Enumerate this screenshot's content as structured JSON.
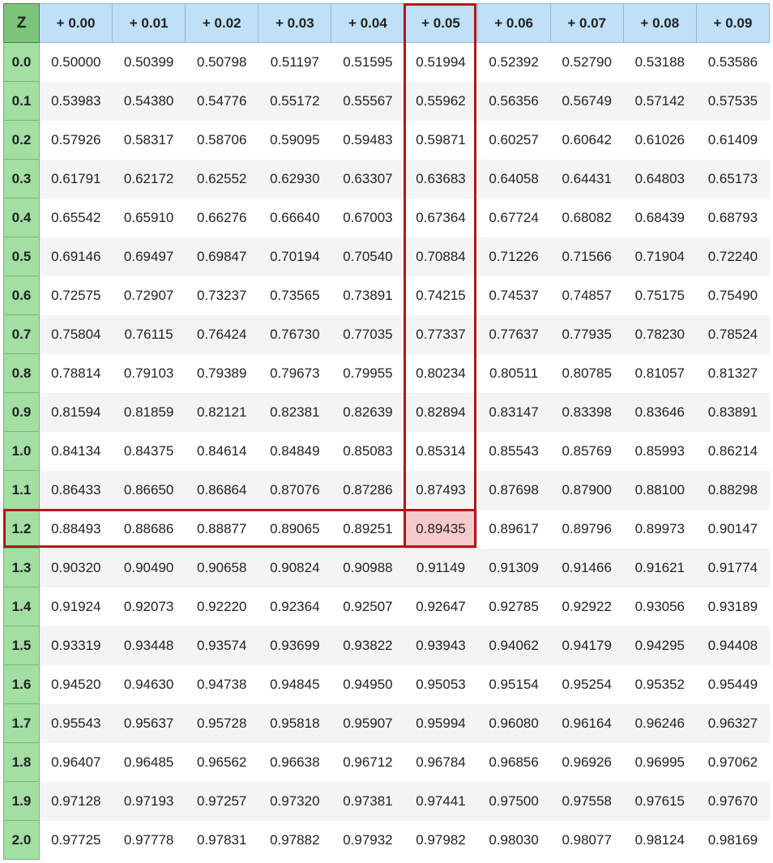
{
  "corner_label": "Z",
  "col_headers": [
    "+ 0.00",
    "+ 0.01",
    "+ 0.02",
    "+ 0.03",
    "+ 0.04",
    "+ 0.05",
    "+ 0.06",
    "+ 0.07",
    "+ 0.08",
    "+ 0.09"
  ],
  "row_headers": [
    "0.0",
    "0.1",
    "0.2",
    "0.3",
    "0.4",
    "0.5",
    "0.6",
    "0.7",
    "0.8",
    "0.9",
    "1.0",
    "1.1",
    "1.2",
    "1.3",
    "1.4",
    "1.5",
    "1.6",
    "1.7",
    "1.8",
    "1.9",
    "2.0"
  ],
  "cells": [
    [
      "0.50000",
      "0.50399",
      "0.50798",
      "0.51197",
      "0.51595",
      "0.51994",
      "0.52392",
      "0.52790",
      "0.53188",
      "0.53586"
    ],
    [
      "0.53983",
      "0.54380",
      "0.54776",
      "0.55172",
      "0.55567",
      "0.55962",
      "0.56356",
      "0.56749",
      "0.57142",
      "0.57535"
    ],
    [
      "0.57926",
      "0.58317",
      "0.58706",
      "0.59095",
      "0.59483",
      "0.59871",
      "0.60257",
      "0.60642",
      "0.61026",
      "0.61409"
    ],
    [
      "0.61791",
      "0.62172",
      "0.62552",
      "0.62930",
      "0.63307",
      "0.63683",
      "0.64058",
      "0.64431",
      "0.64803",
      "0.65173"
    ],
    [
      "0.65542",
      "0.65910",
      "0.66276",
      "0.66640",
      "0.67003",
      "0.67364",
      "0.67724",
      "0.68082",
      "0.68439",
      "0.68793"
    ],
    [
      "0.69146",
      "0.69497",
      "0.69847",
      "0.70194",
      "0.70540",
      "0.70884",
      "0.71226",
      "0.71566",
      "0.71904",
      "0.72240"
    ],
    [
      "0.72575",
      "0.72907",
      "0.73237",
      "0.73565",
      "0.73891",
      "0.74215",
      "0.74537",
      "0.74857",
      "0.75175",
      "0.75490"
    ],
    [
      "0.75804",
      "0.76115",
      "0.76424",
      "0.76730",
      "0.77035",
      "0.77337",
      "0.77637",
      "0.77935",
      "0.78230",
      "0.78524"
    ],
    [
      "0.78814",
      "0.79103",
      "0.79389",
      "0.79673",
      "0.79955",
      "0.80234",
      "0.80511",
      "0.80785",
      "0.81057",
      "0.81327"
    ],
    [
      "0.81594",
      "0.81859",
      "0.82121",
      "0.82381",
      "0.82639",
      "0.82894",
      "0.83147",
      "0.83398",
      "0.83646",
      "0.83891"
    ],
    [
      "0.84134",
      "0.84375",
      "0.84614",
      "0.84849",
      "0.85083",
      "0.85314",
      "0.85543",
      "0.85769",
      "0.85993",
      "0.86214"
    ],
    [
      "0.86433",
      "0.86650",
      "0.86864",
      "0.87076",
      "0.87286",
      "0.87493",
      "0.87698",
      "0.87900",
      "0.88100",
      "0.88298"
    ],
    [
      "0.88493",
      "0.88686",
      "0.88877",
      "0.89065",
      "0.89251",
      "0.89435",
      "0.89617",
      "0.89796",
      "0.89973",
      "0.90147"
    ],
    [
      "0.90320",
      "0.90490",
      "0.90658",
      "0.90824",
      "0.90988",
      "0.91149",
      "0.91309",
      "0.91466",
      "0.91621",
      "0.91774"
    ],
    [
      "0.91924",
      "0.92073",
      "0.92220",
      "0.92364",
      "0.92507",
      "0.92647",
      "0.92785",
      "0.92922",
      "0.93056",
      "0.93189"
    ],
    [
      "0.93319",
      "0.93448",
      "0.93574",
      "0.93699",
      "0.93822",
      "0.93943",
      "0.94062",
      "0.94179",
      "0.94295",
      "0.94408"
    ],
    [
      "0.94520",
      "0.94630",
      "0.94738",
      "0.94845",
      "0.94950",
      "0.95053",
      "0.95154",
      "0.95254",
      "0.95352",
      "0.95449"
    ],
    [
      "0.95543",
      "0.95637",
      "0.95728",
      "0.95818",
      "0.95907",
      "0.95994",
      "0.96080",
      "0.96164",
      "0.96246",
      "0.96327"
    ],
    [
      "0.96407",
      "0.96485",
      "0.96562",
      "0.96638",
      "0.96712",
      "0.96784",
      "0.96856",
      "0.96926",
      "0.96995",
      "0.97062"
    ],
    [
      "0.97128",
      "0.97193",
      "0.97257",
      "0.97320",
      "0.97381",
      "0.97441",
      "0.97500",
      "0.97558",
      "0.97615",
      "0.97670"
    ],
    [
      "0.97725",
      "0.97778",
      "0.97831",
      "0.97882",
      "0.97932",
      "0.97982",
      "0.98030",
      "0.98077",
      "0.98124",
      "0.98169"
    ]
  ],
  "highlight": {
    "row_index": 12,
    "col_index": 5
  },
  "colors": {
    "corner_bg": "#7cc47c",
    "col_header_bg": "#bfe0f7",
    "row_header_bg": "#a3dea3",
    "highlight_border": "#b01818",
    "highlight_cell_bg": "#f6c9cc"
  }
}
